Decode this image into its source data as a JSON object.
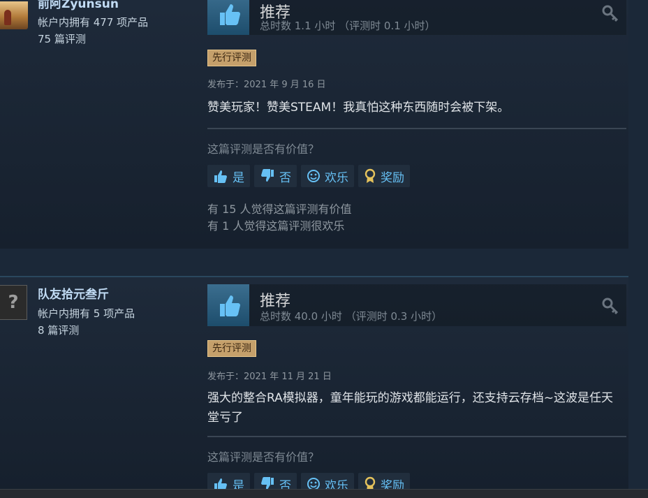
{
  "reviews": [
    {
      "author": "前阿Zyunsun",
      "owned": "帐户内拥有 477 项产品",
      "review_count": "75 篇评测",
      "verdict": "推荐",
      "hours": "总时数 1.1 小时 （评测时 0.1 小时）",
      "badge": "先行评测",
      "posted": "发布于：2021 年 9 月 16 日",
      "text": "赞美玩家！赞美STEAM！我真怕这种东西随时会被下架。",
      "helpful_question": "这篇评测是否有价值？",
      "buttons": {
        "yes": "是",
        "no": "否",
        "funny": "欢乐",
        "award": "奖励"
      },
      "stat_helpful": "有 15 人觉得这篇评测有价值",
      "stat_funny": "有 1 人觉得这篇评测很欢乐"
    },
    {
      "author": "队友拾元叁斤",
      "owned": "帐户内拥有 5 项产品",
      "review_count": "8 篇评测",
      "verdict": "推荐",
      "hours": "总时数 40.0 小时 （评测时 0.3 小时）",
      "badge": "先行评测",
      "posted": "发布于：2021 年 11 月 21 日",
      "text": "强大的整合RA模拟器，童年能玩的游戏都能运行，还支持云存档~这波是任天堂亏了",
      "helpful_question": "这篇评测是否有价值？",
      "buttons": {
        "yes": "是",
        "no": "否",
        "funny": "欢乐",
        "award": "奖励"
      },
      "avatar_placeholder": "?"
    }
  ],
  "icons": {
    "thumb": "thumbs-up-icon",
    "key": "key-icon",
    "yes": "thumbs-up-icon",
    "no": "thumbs-down-icon",
    "funny": "smiley-icon",
    "award": "award-icon"
  },
  "colors": {
    "background": "#1b2838",
    "link_blue": "#66c0f4",
    "badge_gold": "#c5a06b",
    "author_name": "#c1dbf4"
  }
}
